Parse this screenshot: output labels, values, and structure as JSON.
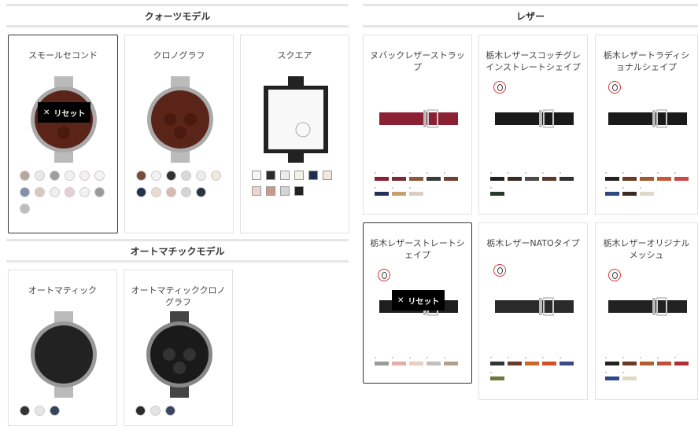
{
  "sections": {
    "quartz": "クォーツモデル",
    "auto": "オートマチックモデル",
    "leather": "レザー"
  },
  "reset_label": "リセット",
  "quartz_cards": [
    {
      "title": "スモールセコンド",
      "selected": true,
      "swatches": [
        "#b9a79e",
        "#e9e9e9",
        "#9e9e9e",
        "#f1f1f1",
        "#f6f0f1",
        "#f4f4f4",
        "#7f8fb0",
        "#d8c9c0",
        "#eee",
        "#e6d0d5",
        "#f2f2f2",
        "#9a9a9a",
        "#bdbdbd"
      ]
    },
    {
      "title": "クロノグラフ",
      "selected": false,
      "swatches": [
        "#7a4a3a",
        "#f2f2f2",
        "#333",
        "#d9d9d9",
        "#ececec",
        "#f0eadd",
        "#23324d",
        "#e9dccf",
        "#d9b8b4",
        "#d5d5d5",
        "#2b3240"
      ]
    },
    {
      "title": "スクエア",
      "selected": false,
      "swatches": [
        "#f4f4f4",
        "#2b2b2b",
        "#ececec",
        "#f1f1ea",
        "#1f2d4f",
        "#f0e8d8",
        "#e8d6cc",
        "#c99a8a",
        "#d4d4d4",
        "#222"
      ]
    }
  ],
  "auto_cards": [
    {
      "title": "オートマティック",
      "swatches": [
        "#333",
        "#e6e6e6",
        "#34445e"
      ]
    },
    {
      "title": "オートマティッククロノグラフ",
      "swatches": [
        "#2b2b2b",
        "#e4e4e4",
        "#3b4660"
      ]
    }
  ],
  "leather_cards": [
    {
      "title": "ヌバックレザーストラップ",
      "selected": false,
      "badge": false,
      "strap": "#8b2033",
      "bars": [
        "#8b2033",
        "#7a2b35",
        "#8a5a3a",
        "#3a3a3a",
        "#704030",
        "#24305a",
        "#c8a070",
        "#d9cfc1"
      ]
    },
    {
      "title": "栃木レザースコッチグレインストレートシェイプ",
      "selected": false,
      "badge": true,
      "strap": "#1a1a1a",
      "bars": [
        "#222",
        "#3a2a22",
        "#4a4a4a",
        "#5a3a2a",
        "#303030",
        "#2a3a2a"
      ]
    },
    {
      "title": "栃木レザートラディショナルシェイプ",
      "selected": false,
      "badge": true,
      "strap": "#1a1a1a",
      "bars": [
        "#222",
        "#6b3a24",
        "#a05a30",
        "#c85a3a",
        "#c84a4a",
        "#2a4a80",
        "#3a2a20",
        "#e0d8c8"
      ]
    },
    {
      "title": "栃木レザーストレートシェイプ",
      "selected": true,
      "badge": true,
      "strap": "#1e1e1e",
      "bars": [
        "#9a9a9a",
        "#e0b0a8",
        "#e8d0c0",
        "#c0c0c0",
        "#b0a090"
      ]
    },
    {
      "title": "栃木レザーNATOタイプ",
      "selected": false,
      "badge": true,
      "strap": "#2a2a2a",
      "bars": [
        "#333",
        "#6a3a2a",
        "#c86a2a",
        "#d0502a",
        "#3a4a8a",
        "#6a7a3a"
      ]
    },
    {
      "title": "栃木レザーオリジナルメッシュ",
      "selected": false,
      "badge": true,
      "strap": "#222",
      "bars": [
        "#222",
        "#6b3a24",
        "#b06030",
        "#c0503a",
        "#b03030",
        "#2a4a8a",
        "#e0d8c0"
      ]
    }
  ]
}
